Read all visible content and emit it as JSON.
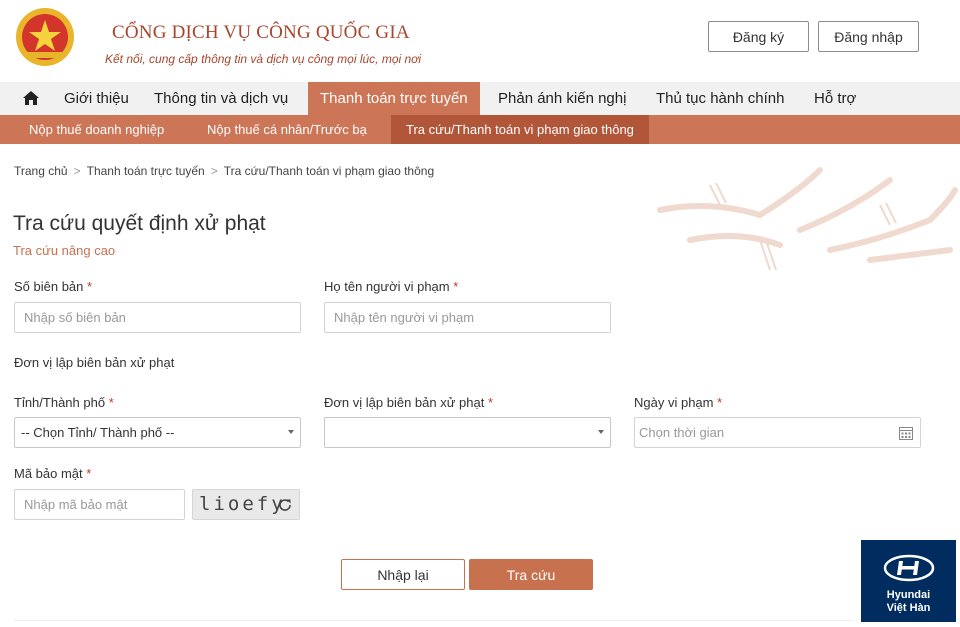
{
  "header": {
    "brand_title": "CỔNG DỊCH VỤ CÔNG QUỐC GIA",
    "brand_subtitle": "Kết nối, cung cấp thông tin và dịch vụ công mọi lúc, mọi nơi",
    "register_label": "Đăng ký",
    "login_label": "Đăng nhập"
  },
  "main_nav": {
    "items": [
      {
        "label": "Giới thiệu"
      },
      {
        "label": "Thông tin và dịch vụ"
      },
      {
        "label": "Thanh toán trực tuyến",
        "active": true
      },
      {
        "label": "Phản ánh kiến nghị"
      },
      {
        "label": "Thủ tục hành chính"
      },
      {
        "label": "Hỗ trợ"
      }
    ]
  },
  "sub_nav": {
    "items": [
      {
        "label": "Nộp thuế doanh nghiệp"
      },
      {
        "label": "Nộp thuế cá nhân/Trước bạ"
      },
      {
        "label": "Tra cứu/Thanh toán vi phạm giao thông",
        "active": true
      }
    ]
  },
  "breadcrumb": {
    "home": "Trang chủ",
    "level1": "Thanh toán trực tuyến",
    "level2": "Tra cứu/Thanh toán vi phạm giao thông",
    "separator": ">"
  },
  "form": {
    "title": "Tra cứu quyết định xử phạt",
    "advanced_link": "Tra cứu nâng cao",
    "required_mark": "*",
    "record_number": {
      "label": "Số biên bản",
      "placeholder": "Nhập số biên bản"
    },
    "violator_name": {
      "label": "Họ tên người vi phạm",
      "placeholder": "Nhập tên người vi phạm"
    },
    "unit_section_heading": "Đơn vị lập biên bản xử phạt",
    "province": {
      "label": "Tỉnh/Thành phố",
      "selected": "-- Chọn Tỉnh/ Thành phố --"
    },
    "issuing_unit": {
      "label": "Đơn vị lập biên bản xử phạt",
      "selected": ""
    },
    "violation_date": {
      "label": "Ngày vi phạm",
      "placeholder": "Chọn thời gian"
    },
    "security_code": {
      "label": "Mã bảo mật",
      "placeholder": "Nhập mã bảo mật",
      "captcha_text": "lioefy"
    },
    "reset_label": "Nhập lại",
    "search_label": "Tra cứu"
  },
  "sponsor": {
    "name": "Hyundai",
    "subtitle": "Việt Hàn"
  },
  "colors": {
    "accent": "#cd7557",
    "accent_dark": "#b2563a",
    "brand_text": "#a8462d",
    "sponsor_bg": "#002c5f"
  }
}
